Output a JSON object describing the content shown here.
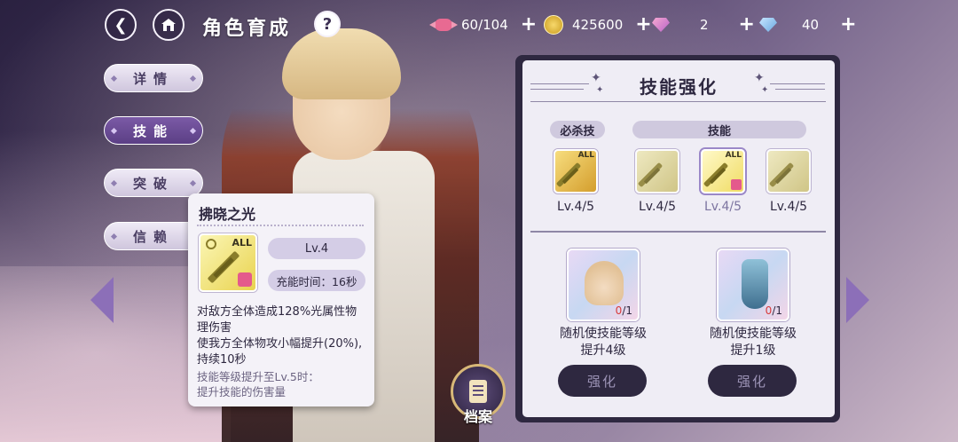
{
  "header": {
    "title": "角色育成",
    "resources": [
      {
        "icon": "candy-icon",
        "value": "60/104"
      },
      {
        "icon": "coin-icon",
        "value": "425600"
      },
      {
        "icon": "pink-gem-icon",
        "value": "2"
      },
      {
        "icon": "blue-gem-icon",
        "value": "40"
      }
    ]
  },
  "sidebar": {
    "items": [
      {
        "label": "详情"
      },
      {
        "label": "技能"
      },
      {
        "label": "突破"
      },
      {
        "label": "信赖"
      }
    ],
    "active_index": 1
  },
  "tooltip": {
    "title": "拂晓之光",
    "badge": "ALL",
    "level": "Lv.4",
    "charge_time": "充能时间：16秒",
    "description": "对敌方全体造成128%光属性物理伤害\n使我方全体物攻小幅提升(20%),持续10秒",
    "upgrade_note": "技能等级提升至Lv.5时：\n提升技能的伤害量"
  },
  "archive": {
    "label": "档案"
  },
  "panel": {
    "title": "技能强化",
    "ultimate_label": "必杀技",
    "skills_label": "技能",
    "skills": [
      {
        "level": "Lv.4/5",
        "badge": "ALL"
      },
      {
        "level": "Lv.4/5",
        "badge": ""
      },
      {
        "level": "Lv.4/5",
        "badge": "ALL"
      },
      {
        "level": "Lv.4/5",
        "badge": ""
      }
    ],
    "selected_skill": 2,
    "items": [
      {
        "count_have": "0",
        "count_need": "/1",
        "text": "随机使技能等级\n提升4级",
        "button": "强化"
      },
      {
        "count_have": "0",
        "count_need": "/1",
        "text": "随机使技能等级\n提升1级",
        "button": "强化"
      }
    ]
  }
}
